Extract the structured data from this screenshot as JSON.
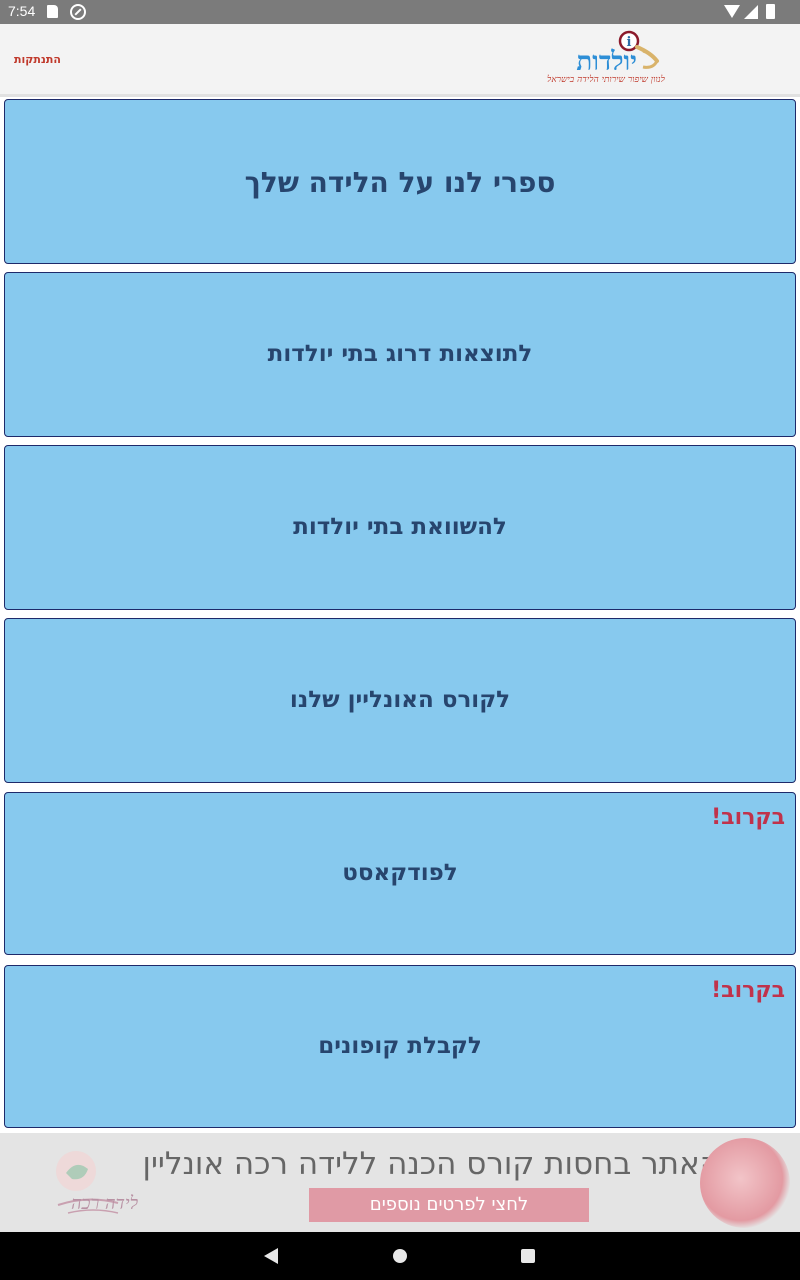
{
  "status_bar": {
    "time": "7:54"
  },
  "header": {
    "logout_label": "התנתקות",
    "logo_text": "יולדות",
    "logo_tagline": "לנוון שיפור שירותי הלידה בישראל"
  },
  "menu": {
    "items": [
      {
        "label": "ספרי לנו על הלידה שלך",
        "badge": ""
      },
      {
        "label": "לתוצאות דרוג בתי יולדות",
        "badge": ""
      },
      {
        "label": "להשוואת בתי יולדות",
        "badge": ""
      },
      {
        "label": "לקורס האונליין שלנו",
        "badge": ""
      },
      {
        "label": "לפודקאסט",
        "badge": "בקרוב!"
      },
      {
        "label": "לקבלת קופונים",
        "badge": "בקרוב!"
      }
    ]
  },
  "banner": {
    "headline": "האתר בחסות קורס הכנה ללידה רכה אונליין",
    "cta_label": "לחצי לפרטים נוספים",
    "brand_logo_text": "לידה רכה"
  },
  "colors": {
    "card_bg": "#87c9ee",
    "card_text": "#27456e",
    "badge": "#c0324b",
    "cta_bg": "#e09aa5"
  }
}
